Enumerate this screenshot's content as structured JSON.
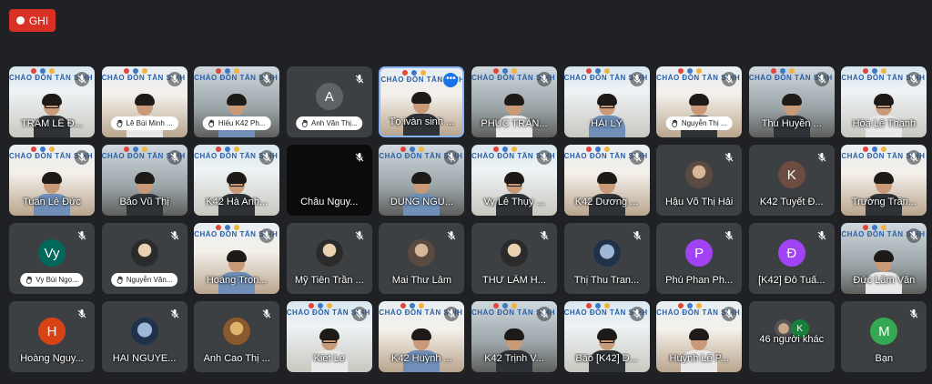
{
  "record": {
    "label": "GHI",
    "color": "#d93025"
  },
  "banner_text": "CHÀO ĐÓN TÂN SINH VIÊN K42",
  "others": {
    "label": "46 người khác",
    "initial": "K"
  },
  "participants": [
    {
      "name": "TRÂM LÊ Đ...",
      "type": "video"
    },
    {
      "name": "Lê Bùi Minh ...",
      "type": "video-hand"
    },
    {
      "name": "Hiếu K42 Ph...",
      "type": "video-hand"
    },
    {
      "name": "Anh Văn Thị...",
      "type": "avatar-hand",
      "initial": "A",
      "color": "#5f6368"
    },
    {
      "name": "Tọ ivàn sinh ...",
      "type": "video-active"
    },
    {
      "name": "PHÚC TRẦN...",
      "type": "video"
    },
    {
      "name": "HẢI LÝ",
      "type": "video"
    },
    {
      "name": "Nguyễn Thị ...",
      "type": "video-hand"
    },
    {
      "name": "Thu Huyền ...",
      "type": "video"
    },
    {
      "name": "Hòa Lê Thanh",
      "type": "video"
    },
    {
      "name": "Tuấn Lê Đức",
      "type": "video"
    },
    {
      "name": "Bảo Vũ Thị",
      "type": "video"
    },
    {
      "name": "K42 Hà Anh...",
      "type": "video"
    },
    {
      "name": "Châu Nguy...",
      "type": "black"
    },
    {
      "name": "DUNG NGU...",
      "type": "video"
    },
    {
      "name": "Vy Lê Thụy ...",
      "type": "video"
    },
    {
      "name": "K42 Dương ...",
      "type": "video"
    },
    {
      "name": "Hậu Võ Thị Hải",
      "type": "avatar",
      "avatar": "photo"
    },
    {
      "name": "K42 Tuyết Đ...",
      "type": "avatar",
      "initial": "K",
      "color": "#6d4c41"
    },
    {
      "name": "Trường Trần...",
      "type": "video"
    },
    {
      "name": "Vy Bùi Ngọ...",
      "type": "avatar-hand",
      "initial": "Vy",
      "color": "#00695c"
    },
    {
      "name": "Nguyễn Văn...",
      "type": "avatar-hand",
      "avatar": "photo2"
    },
    {
      "name": "Hoàng Trọn...",
      "type": "video"
    },
    {
      "name": "Mỹ Tiên Trần ...",
      "type": "avatar",
      "avatar": "photo2"
    },
    {
      "name": "Mai Thư Lâm",
      "type": "avatar",
      "avatar": "photo"
    },
    {
      "name": "THƯ LÂM H...",
      "type": "avatar",
      "avatar": "photo2"
    },
    {
      "name": "Thị Thu Tran...",
      "type": "avatar",
      "avatar": "photo3"
    },
    {
      "name": "Phú Phan Ph...",
      "type": "avatar",
      "initial": "P",
      "color": "#a142f4"
    },
    {
      "name": "[K42] Đỗ Tuấ...",
      "type": "avatar",
      "initial": "Đ",
      "color": "#a142f4"
    },
    {
      "name": "Đức Lâm Văn",
      "type": "video"
    },
    {
      "name": "Hoàng Nguy...",
      "type": "avatar",
      "initial": "H",
      "color": "#d84315"
    },
    {
      "name": "HAI NGUYE...",
      "type": "avatar",
      "avatar": "photo3"
    },
    {
      "name": "Anh Cao Thị ...",
      "type": "avatar",
      "avatar": "photo4"
    },
    {
      "name": "Kiet Le",
      "type": "video"
    },
    {
      "name": "K42 Huỳnh ...",
      "type": "video"
    },
    {
      "name": "K42 Trịnh V...",
      "type": "video"
    },
    {
      "name": "Bảo [K42] D...",
      "type": "video"
    },
    {
      "name": "Huỳnh Lê P...",
      "type": "video"
    },
    {
      "name": "46 người khác",
      "type": "others"
    },
    {
      "name": "Bạn",
      "type": "avatar",
      "initial": "M",
      "color": "#34a853"
    }
  ]
}
